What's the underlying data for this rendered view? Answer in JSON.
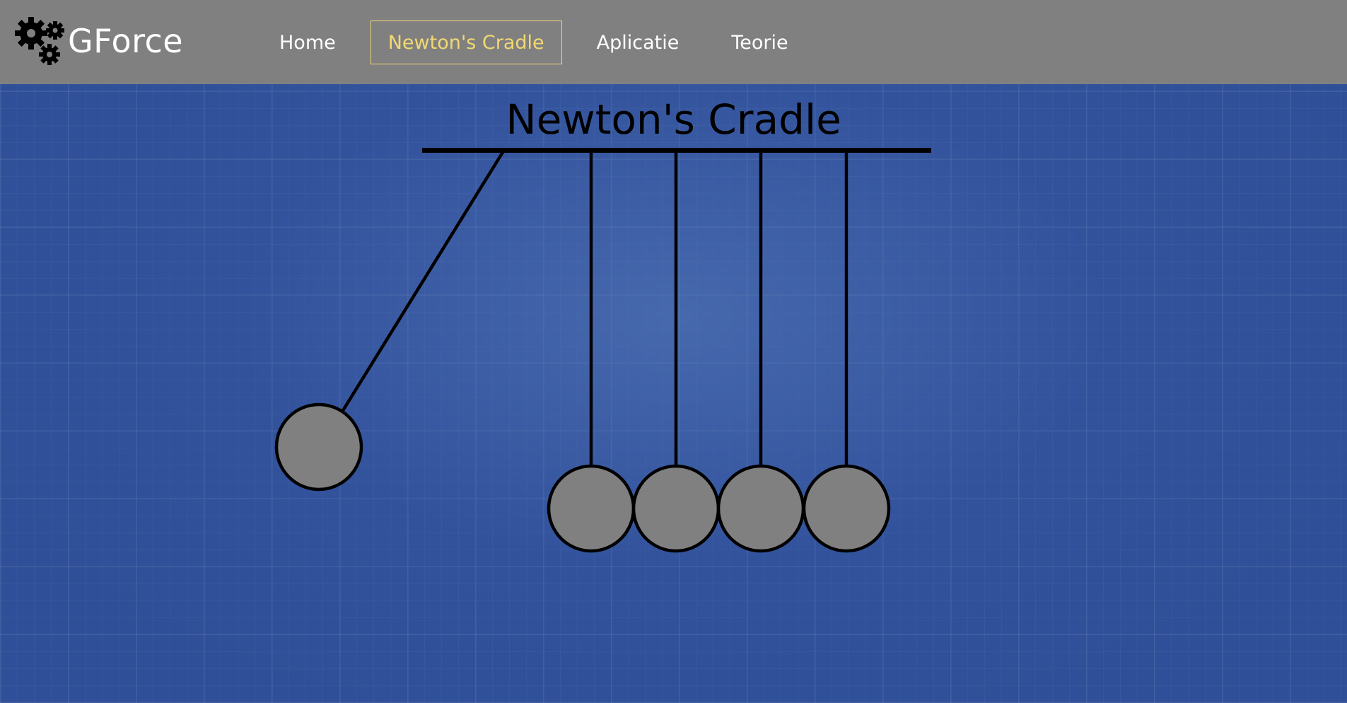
{
  "brand": {
    "name": "GForce",
    "icon": "gears-icon"
  },
  "nav": {
    "items": [
      {
        "label": "Home",
        "active": false
      },
      {
        "label": "Newton's Cradle",
        "active": true
      },
      {
        "label": "Aplicatie",
        "active": false
      },
      {
        "label": "Teorie",
        "active": false
      }
    ]
  },
  "page": {
    "title": "Newton's Cradle"
  },
  "colors": {
    "navbar": "#808080",
    "accent": "#f2d872",
    "background": "#2f4f98",
    "ball": "#808080",
    "line": "#000000"
  },
  "cradle": {
    "ball_count": 5,
    "raised_ball": "first"
  }
}
